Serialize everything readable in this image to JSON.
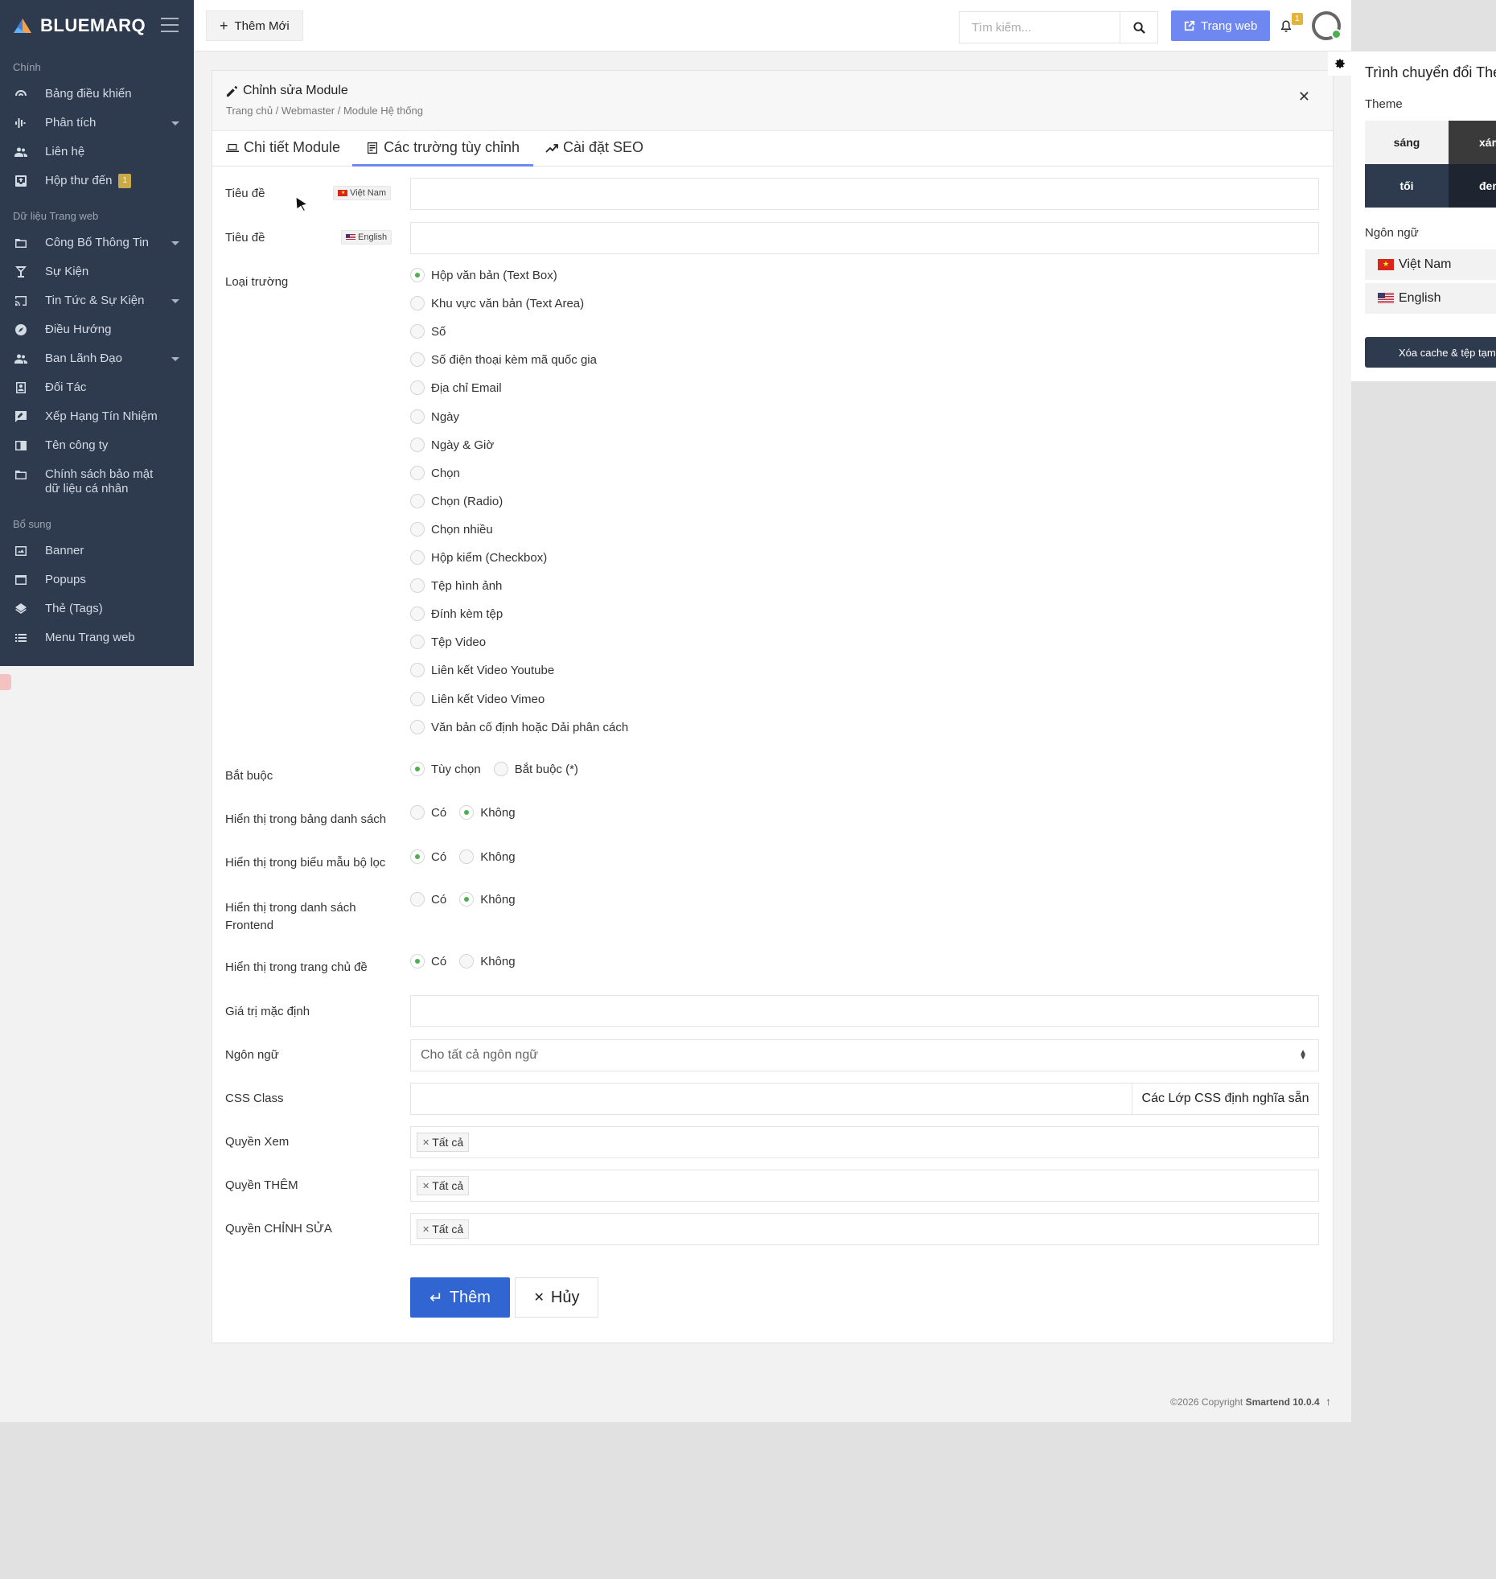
{
  "app": {
    "brand": "BLUEMARQ"
  },
  "sidebar": {
    "sections": [
      {
        "title": "Chính",
        "items": [
          {
            "label": "Bảng điều khiển",
            "icon": "dashboard-icon"
          },
          {
            "label": "Phân tích",
            "icon": "analytics-icon",
            "has_caret": true
          },
          {
            "label": "Liên hệ",
            "icon": "contacts-icon"
          },
          {
            "label": "Hộp thư đến",
            "icon": "inbox-icon",
            "badge": "1"
          }
        ]
      },
      {
        "title": "Dữ liệu Trang web",
        "items": [
          {
            "label": "Công Bố Thông Tin",
            "icon": "folder-icon",
            "has_caret": true
          },
          {
            "label": "Sự Kiện",
            "icon": "cocktail-icon"
          },
          {
            "label": "Tin Tức & Sự Kiện",
            "icon": "cast-icon",
            "has_caret": true
          },
          {
            "label": "Điều Hướng",
            "icon": "compass-icon"
          },
          {
            "label": "Ban Lãnh Đạo",
            "icon": "people-icon",
            "has_caret": true
          },
          {
            "label": "Đối Tác",
            "icon": "contact-card-icon"
          },
          {
            "label": "Xếp Hạng Tín Nhiệm",
            "icon": "feedback-icon"
          },
          {
            "label": "Tên công ty",
            "icon": "chrome-reader-icon"
          },
          {
            "label": "Chính sách bảo mật dữ liệu cá nhân",
            "icon": "folder-icon"
          }
        ]
      },
      {
        "title": "Bổ sung",
        "items": [
          {
            "label": "Banner",
            "icon": "banner-icon"
          },
          {
            "label": "Popups",
            "icon": "popup-icon"
          },
          {
            "label": "Thẻ (Tags)",
            "icon": "layers-icon"
          },
          {
            "label": "Menu Trang web",
            "icon": "list-icon"
          }
        ]
      }
    ]
  },
  "topbar": {
    "new_button": "Thêm Mới",
    "search_placeholder": "Tìm kiếm...",
    "website_button": "Trang web",
    "notification_count": "1"
  },
  "card": {
    "title": "Chỉnh sửa Module",
    "breadcrumb": "Trang chủ / Webmaster / Module Hệ thống",
    "tabs": [
      {
        "label": "Chi tiết Module",
        "active": false
      },
      {
        "label": "Các trường tùy chỉnh",
        "active": true
      },
      {
        "label": "Cài đặt SEO",
        "active": false
      }
    ]
  },
  "form": {
    "title_label": "Tiêu đề",
    "lang_vi": "Việt Nam",
    "lang_en": "English",
    "field_type_label": "Loại trường",
    "field_types": [
      {
        "label": "Hộp văn bản (Text Box)",
        "checked": true
      },
      {
        "label": "Khu vực văn bản (Text Area)",
        "checked": false
      },
      {
        "label": "Số",
        "checked": false
      },
      {
        "label": "Số điện thoại kèm mã quốc gia",
        "checked": false
      },
      {
        "label": "Địa chỉ Email",
        "checked": false
      },
      {
        "label": "Ngày",
        "checked": false
      },
      {
        "label": "Ngày & Giờ",
        "checked": false
      },
      {
        "label": "Chọn",
        "checked": false
      },
      {
        "label": "Chọn (Radio)",
        "checked": false
      },
      {
        "label": "Chọn nhiều",
        "checked": false
      },
      {
        "label": "Hộp kiểm (Checkbox)",
        "checked": false
      },
      {
        "label": "Tệp hình ảnh",
        "checked": false
      },
      {
        "label": "Đính kèm tệp",
        "checked": false
      },
      {
        "label": "Tệp Video",
        "checked": false
      },
      {
        "label": "Liên kết Video Youtube",
        "checked": false
      },
      {
        "label": "Liên kết Video Vimeo",
        "checked": false
      },
      {
        "label": "Văn bản cố định hoặc Dải phân cách",
        "checked": false
      }
    ],
    "required": {
      "label": "Bắt buộc",
      "options": [
        "Tùy chọn",
        "Bắt buộc (*)"
      ],
      "selected": 0
    },
    "show_in_table": {
      "label": "Hiển thị trong bảng danh sách",
      "options": [
        "Có",
        "Không"
      ],
      "selected": 1
    },
    "show_in_filter": {
      "label": "Hiển thị trong biểu mẫu bộ lọc",
      "options": [
        "Có",
        "Không"
      ],
      "selected": 0
    },
    "show_in_frontend": {
      "label": "Hiển thị trong danh sách Frontend",
      "options": [
        "Có",
        "Không"
      ],
      "selected": 1
    },
    "show_in_topic": {
      "label": "Hiển thị trong trang chủ đề",
      "options": [
        "Có",
        "Không"
      ],
      "selected": 0
    },
    "default_value_label": "Giá trị mặc định",
    "language_label": "Ngôn ngữ",
    "language_value": "Cho tất cả ngôn ngữ",
    "css_label": "CSS Class",
    "css_button": "Các Lớp CSS định nghĩa sẵn",
    "view_perm_label": "Quyền Xem",
    "add_perm_label": "Quyền THÊM",
    "edit_perm_label": "Quyền CHỈNH SỬA",
    "perm_tag": "Tất cả",
    "submit": "Thêm",
    "cancel": "Hủy"
  },
  "footer": {
    "copyright": "©2026 Copyright",
    "product": "Smartend 10.0.4"
  },
  "theme_panel": {
    "title": "Trình chuyển đổi Theme",
    "theme_label": "Theme",
    "themes": [
      "sáng",
      "xám",
      "tối",
      "đen"
    ],
    "lang_label": "Ngôn ngữ",
    "languages": [
      "Việt Nam",
      "English"
    ],
    "clear_cache": "Xóa cache & tệp tạm?"
  },
  "colors": {
    "sidebar_bg": "#2e3b4e",
    "primary": "#3166d2",
    "accent": "#6f87f0",
    "radio_active": "#4caf50"
  }
}
